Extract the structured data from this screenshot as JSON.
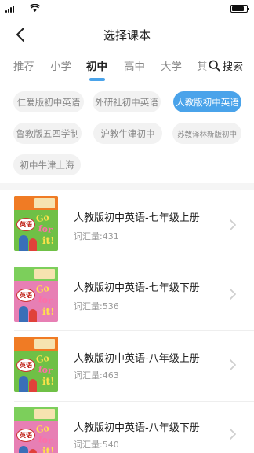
{
  "app": {
    "title": "选择课本"
  },
  "tabs": [
    {
      "label": "推荐",
      "active": false
    },
    {
      "label": "小学",
      "active": false
    },
    {
      "label": "初中",
      "active": true
    },
    {
      "label": "高中",
      "active": false
    },
    {
      "label": "大学",
      "active": false
    },
    {
      "label": "其",
      "active": false,
      "partial": true
    }
  ],
  "search": {
    "label": "搜索",
    "icon": "search-icon"
  },
  "publishers": [
    {
      "label": "仁爱版初中英语",
      "active": false
    },
    {
      "label": "外研社初中英语",
      "active": false
    },
    {
      "label": "人教版初中英语",
      "active": true
    },
    {
      "label": "鲁教版五四学制",
      "active": false
    },
    {
      "label": "沪教牛津初中",
      "active": false
    },
    {
      "label": "苏教译林新版初中",
      "active": false
    },
    {
      "label": "初中牛津上海",
      "active": false
    }
  ],
  "books": [
    {
      "title": "人教版初中英语-七年级上册",
      "vocab": "词汇量:431",
      "cover": "英语"
    },
    {
      "title": "人教版初中英语-七年级下册",
      "vocab": "词汇量:536",
      "cover": "英语"
    },
    {
      "title": "人教版初中英语-八年级上册",
      "vocab": "词汇量:463",
      "cover": "英语"
    },
    {
      "title": "人教版初中英语-八年级下册",
      "vocab": "词汇量:540",
      "cover": "英语"
    }
  ],
  "cover_art": {
    "go": "Go",
    "for": "for",
    "it": "it!"
  },
  "colors": {
    "accent": "#4aa3ea",
    "chip_bg": "#f2f2f2",
    "chip_text": "#888888"
  }
}
